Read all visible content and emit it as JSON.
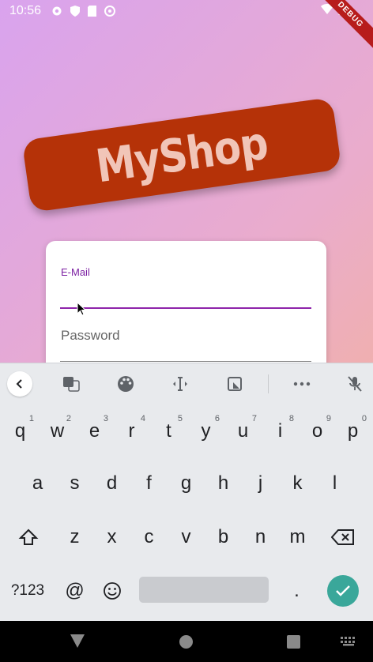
{
  "status_bar": {
    "time": "10:56",
    "debug_label": "DEBUG"
  },
  "logo": {
    "text": "MyShop"
  },
  "auth_form": {
    "email_label": "E-Mail",
    "email_value": "",
    "password_placeholder": "Password"
  },
  "keyboard": {
    "toolbar_icons": [
      "back-arrow-icon",
      "translate-icon",
      "palette-icon",
      "text-cursor-icon",
      "clipboard-icon",
      "more-icon",
      "mic-off-icon"
    ],
    "row1": [
      {
        "key": "q",
        "hint": "1"
      },
      {
        "key": "w",
        "hint": "2"
      },
      {
        "key": "e",
        "hint": "3"
      },
      {
        "key": "r",
        "hint": "4"
      },
      {
        "key": "t",
        "hint": "5"
      },
      {
        "key": "y",
        "hint": "6"
      },
      {
        "key": "u",
        "hint": "7"
      },
      {
        "key": "i",
        "hint": "8"
      },
      {
        "key": "o",
        "hint": "9"
      },
      {
        "key": "p",
        "hint": "0"
      }
    ],
    "row2": [
      "a",
      "s",
      "d",
      "f",
      "g",
      "h",
      "j",
      "k",
      "l"
    ],
    "row3": [
      "z",
      "x",
      "c",
      "v",
      "b",
      "n",
      "m"
    ],
    "symbols_label": "?123",
    "at_label": "@",
    "period_label": "."
  },
  "colors": {
    "accent": "#8e24aa",
    "logo_bg": "#b53208",
    "logo_text": "#f1c5b8",
    "enter_key": "#3aa79a"
  }
}
